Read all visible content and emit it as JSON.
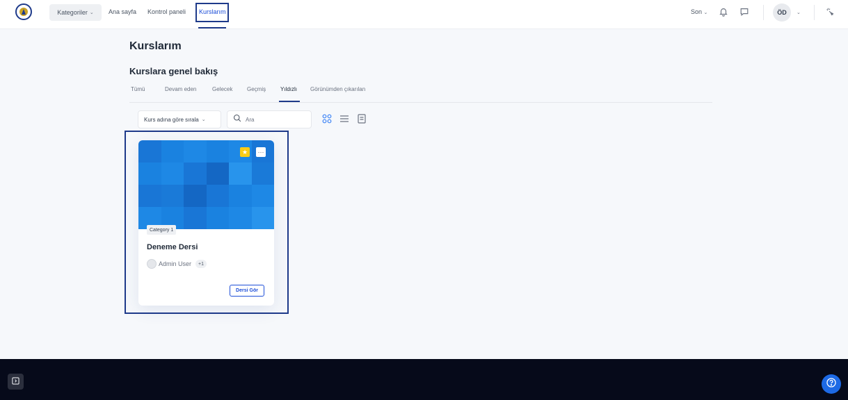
{
  "nav": {
    "categories_label": "Kategoriler",
    "links": [
      "Ana sayfa",
      "Kontrol paneli",
      "Kurslarım"
    ],
    "lang_label": "Son",
    "user_initials": "ÖD"
  },
  "page": {
    "title": "Kurslarım",
    "section_title": "Kurslara genel bakış",
    "tabs": [
      "Tümü",
      "Devam eden",
      "Gelecek",
      "Geçmiş",
      "Yıldızlı",
      "Görünümden çıkarılan"
    ],
    "active_tab": "Yıldızlı"
  },
  "controls": {
    "sort_label": "Kurs adına göre sırala",
    "search_placeholder": "Ara",
    "view_icons": [
      "card-view-icon",
      "list-view-icon",
      "summary-view-icon"
    ]
  },
  "course": {
    "category": "Category 1",
    "name": "Deneme Dersi",
    "teacher": "Admin User",
    "extra_count": "+1",
    "button_label": "Dersi Gör",
    "starred": true
  },
  "colors": {
    "primary": "#1d4ed8",
    "highlight_border": "#1e3a8a",
    "star": "#facc15",
    "footer": "#060a1a"
  }
}
